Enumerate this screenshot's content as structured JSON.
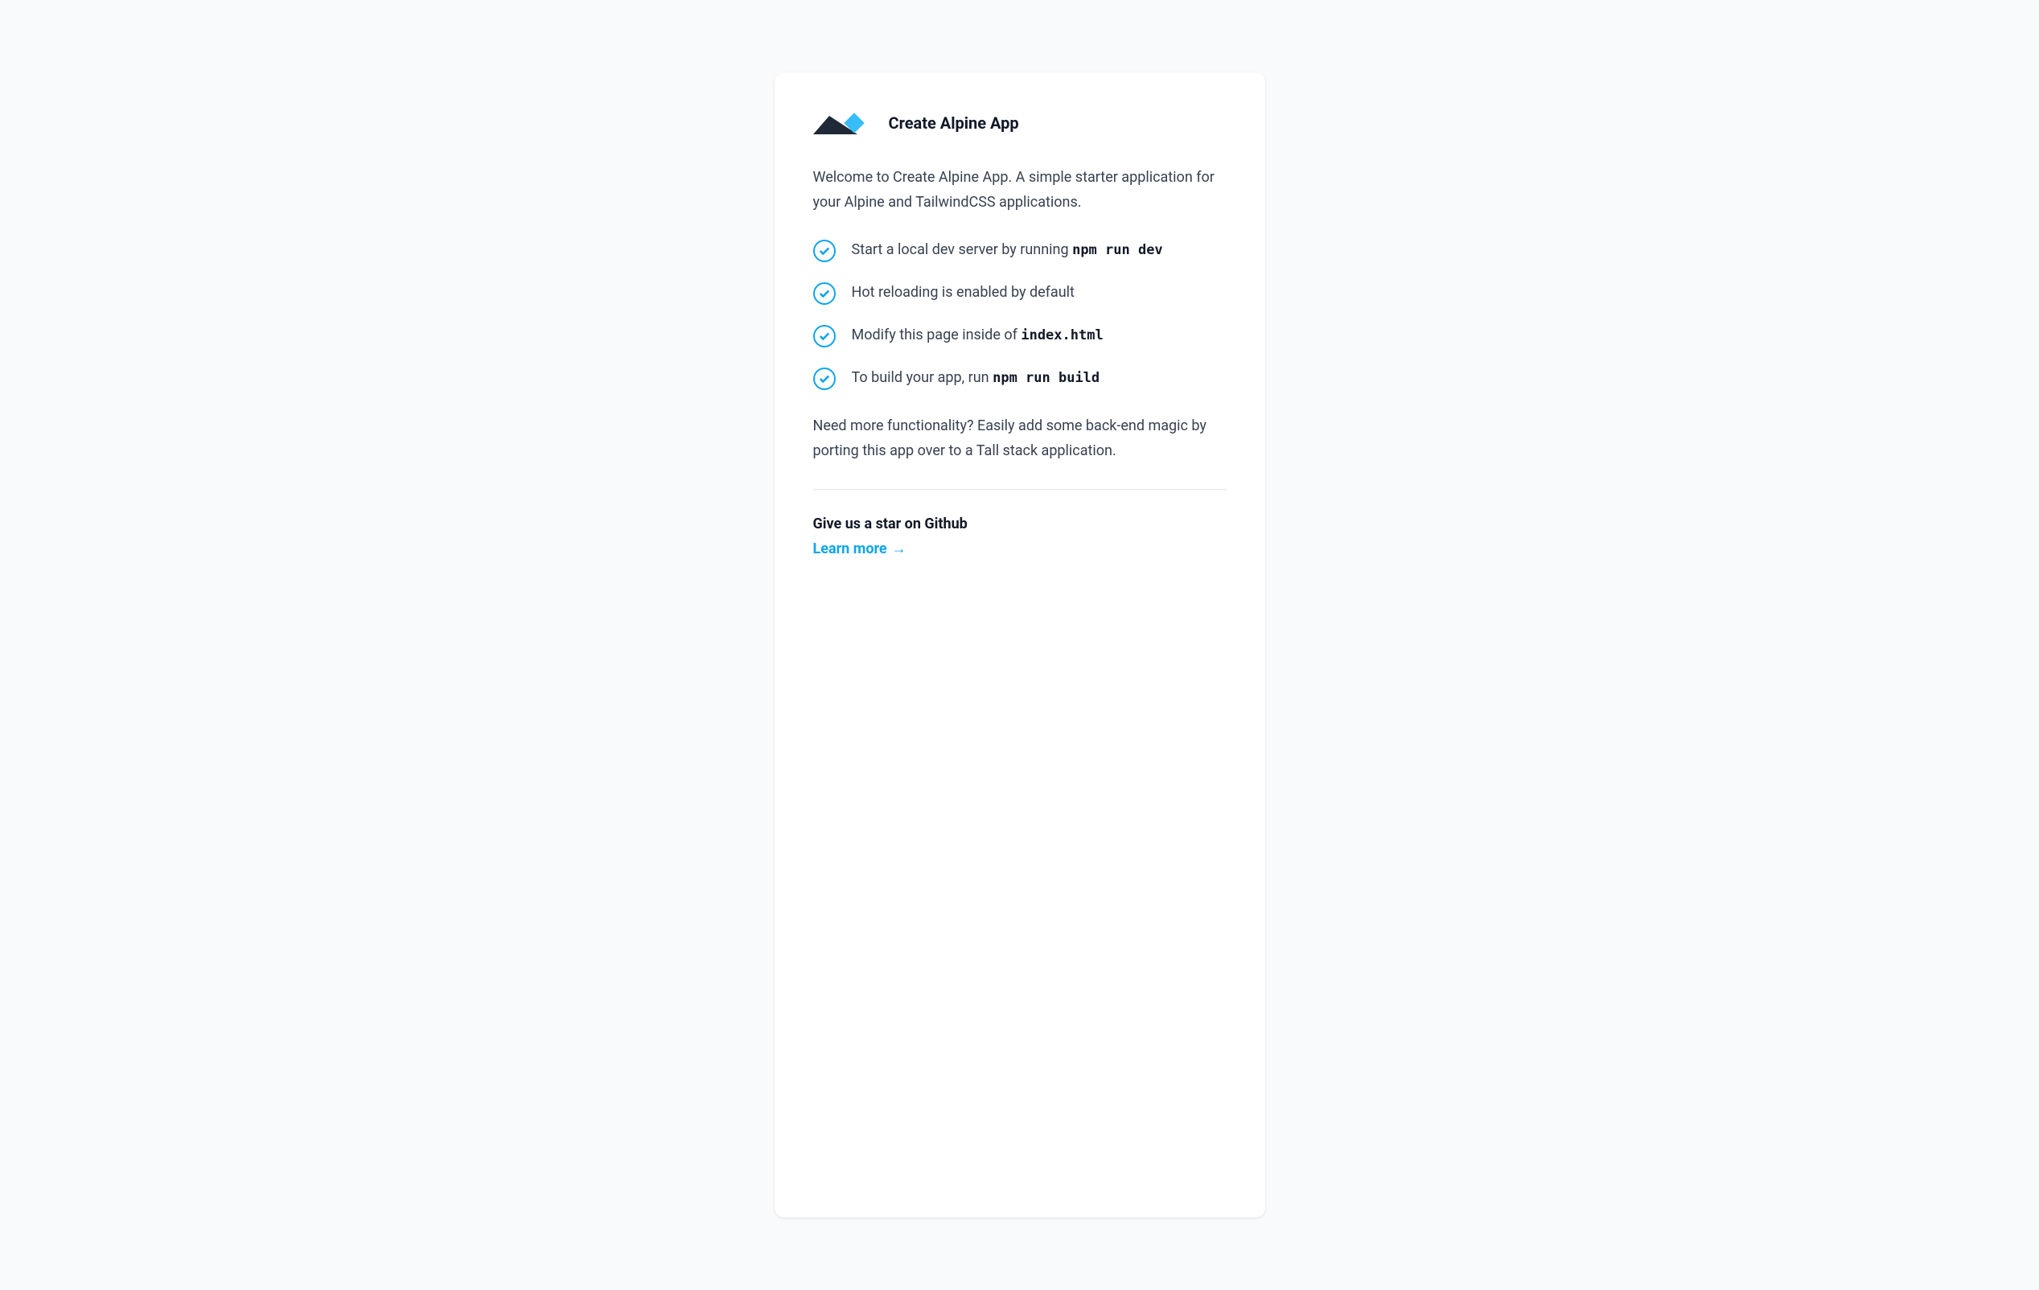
{
  "card": {
    "title": "Create Alpine App",
    "intro": "Welcome to Create Alpine App. A simple starter application for your Alpine and TailwindCSS applications.",
    "features": [
      {
        "text": "Start a local dev server by running ",
        "code": "npm run dev"
      },
      {
        "text": "Hot reloading is enabled by default",
        "code": ""
      },
      {
        "text": "Modify this page inside of ",
        "code": "index.html"
      },
      {
        "text": "To build your app, run ",
        "code": "npm run build"
      }
    ],
    "outro": "Need more functionality? Easily add some back-end magic by porting this app over to a Tall stack application.",
    "cta_heading": "Give us a star on Github",
    "cta_link_label": "Learn more",
    "cta_link_arrow": "→"
  },
  "colors": {
    "accent": "#0ea5e9",
    "text": "#374151",
    "heading": "#111827",
    "background": "#f9fafb",
    "card_bg": "#ffffff"
  }
}
